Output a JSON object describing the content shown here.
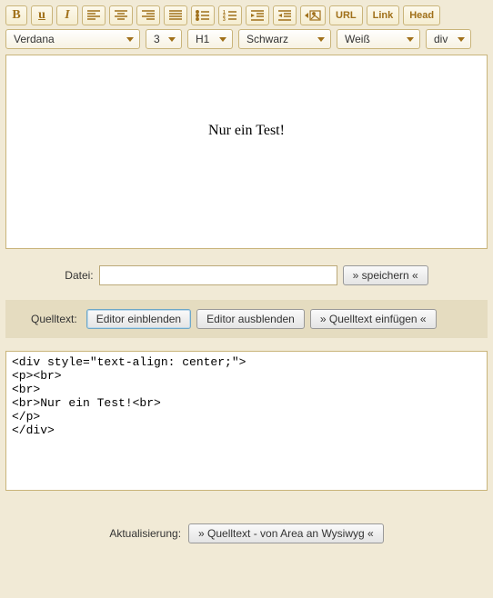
{
  "toolbar": {
    "bold": "B",
    "underline": "u",
    "italic": "I",
    "url": "URL",
    "link": "Link",
    "head": "Head"
  },
  "selects": {
    "font": "Verdana",
    "size": "3",
    "heading": "H1",
    "fgcolor": "Schwarz",
    "bgcolor": "Weiß",
    "tag": "div"
  },
  "editor": {
    "content_text": "Nur ein Test!"
  },
  "file": {
    "label": "Datei:",
    "value": "",
    "save_btn": "» speichern «"
  },
  "source_panel": {
    "label": "Quelltext:",
    "show_btn": "Editor einblenden",
    "hide_btn": "Editor ausblenden",
    "insert_btn": "» Quelltext einfügen «"
  },
  "source_code": "<div style=\"text-align: center;\">\n<p><br>\n<br>\n<br>Nur ein Test!<br>\n</p>\n</div>",
  "footer": {
    "label": "Aktualisierung:",
    "btn": "» Quelltext - von Area an Wysiwyg «"
  }
}
